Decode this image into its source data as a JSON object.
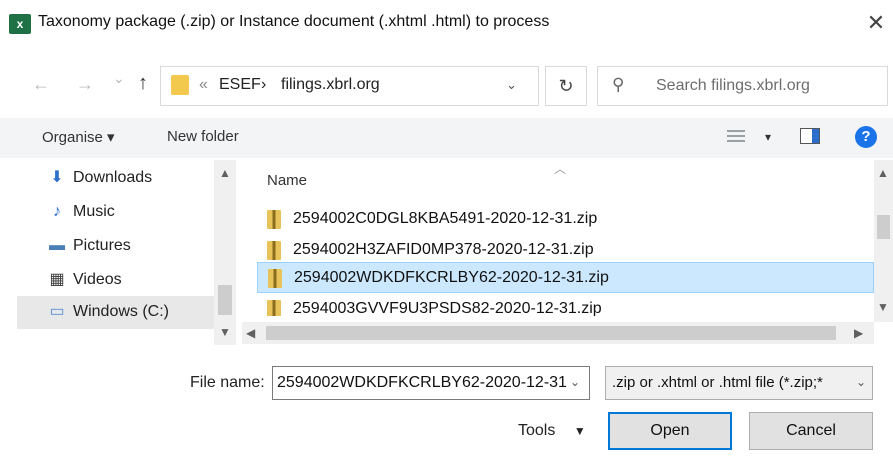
{
  "window": {
    "app_icon_text": "x",
    "title": "Taxonomy package (.zip) or Instance document (.xhtml .html) to process",
    "close_glyph": "✕"
  },
  "address": {
    "back_glyph": "←",
    "forward_glyph": "→",
    "recent_glyph": "⌄",
    "up_glyph": "↑",
    "overflow": "«",
    "crumbs": [
      "ESEF",
      "filings.xbrl.org"
    ],
    "separator": "›",
    "dropdown_glyph": "⌄",
    "refresh_glyph": "↻"
  },
  "search": {
    "placeholder": "Search filings.xbrl.org",
    "icon": "search-icon"
  },
  "toolbar": {
    "organise_label": "Organise ▾",
    "new_folder_label": "New folder",
    "view_menu_glyph": "▾",
    "help_glyph": "?"
  },
  "nav": {
    "items": [
      {
        "label": "Downloads",
        "icon": "download-icon",
        "glyph": "⬇",
        "color": "#2b6ecb"
      },
      {
        "label": "Music",
        "icon": "music-icon",
        "glyph": "♪",
        "color": "#2b6ecb"
      },
      {
        "label": "Pictures",
        "icon": "pictures-icon",
        "glyph": "▬",
        "color": "#4a7fb5"
      },
      {
        "label": "Videos",
        "icon": "videos-icon",
        "glyph": "▦",
        "color": "#3a3a3a"
      },
      {
        "label": "Windows (C:)",
        "icon": "drive-icon",
        "glyph": "▭",
        "color": "#5b8fd6",
        "selected": true
      }
    ]
  },
  "files": {
    "column_header": "Name",
    "rows": [
      {
        "name": "2594002C0DGL8KBA5491-2020-12-31.zip",
        "selected": false
      },
      {
        "name": "2594002H3ZAFID0MP378-2020-12-31.zip",
        "selected": false
      },
      {
        "name": "2594002WDKDFKCRLBY62-2020-12-31.zip",
        "selected": true
      },
      {
        "name": "2594003GVVF9U3PSDS82-2020-12-31.zip",
        "selected": false
      }
    ]
  },
  "bottom": {
    "file_name_label": "File name:",
    "file_name_value": "2594002WDKDFKCRLBY62-2020-12-31",
    "file_type_value": ".zip or .xhtml or .html file (*.zip;*",
    "tools_label": "Tools",
    "open_label": "Open",
    "cancel_label": "Cancel"
  },
  "colors": {
    "selection": "#cce8ff",
    "accent": "#0078d7",
    "excel_green": "#1e7145"
  }
}
